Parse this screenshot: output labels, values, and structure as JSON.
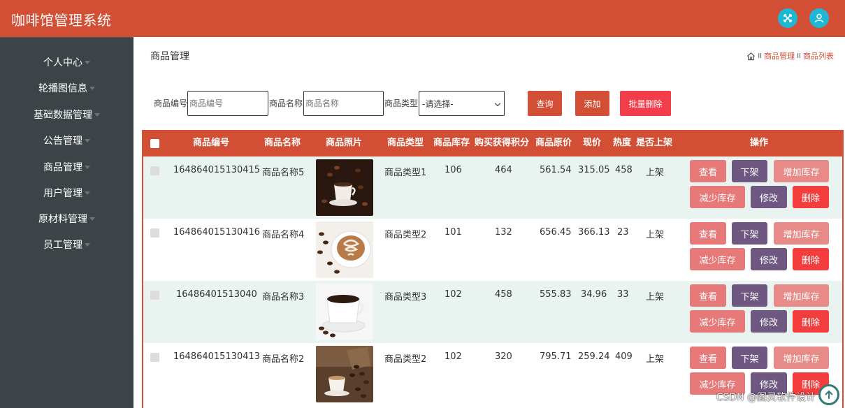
{
  "app": {
    "title": "咖啡馆管理系统"
  },
  "sidebar": {
    "items": [
      {
        "label": "个人中心"
      },
      {
        "label": "轮播图信息"
      },
      {
        "label": "基础数据管理"
      },
      {
        "label": "公告管理"
      },
      {
        "label": "商品管理"
      },
      {
        "label": "用户管理"
      },
      {
        "label": "原材料管理"
      },
      {
        "label": "员工管理"
      }
    ]
  },
  "page": {
    "title": "商品管理",
    "breadcrumb": {
      "sep": "II",
      "level1": "商品管理",
      "level2": "商品列表"
    }
  },
  "filters": {
    "code": {
      "label": "商品编号",
      "placeholder": "商品编号"
    },
    "name": {
      "label": "商品名称",
      "placeholder": "商品名称"
    },
    "type": {
      "label": "商品类型",
      "value": "-请选择-"
    },
    "search_label": "查询",
    "add_label": "添加",
    "batch_delete_label": "批量删除"
  },
  "colors": {
    "brand": "#d24e34",
    "sidebar": "#3d4447",
    "header_button": "#1fb7d6",
    "view": "#e77a78",
    "offline": "#6e5882",
    "delete": "#f43d3d"
  },
  "table": {
    "headers": {
      "code": "商品编号",
      "name": "商品名称",
      "photo": "商品照片",
      "type": "商品类型",
      "stock": "商品库存",
      "points": "购买获得积分",
      "orig_price": "商品原价",
      "price": "现价",
      "hot": "热度",
      "listed": "是否上架",
      "ops": "操作"
    },
    "actions": {
      "view": "查看",
      "offline": "下架",
      "add_stock": "增加库存",
      "reduce_stock": "减少库存",
      "edit": "修改",
      "delete": "删除"
    },
    "rows": [
      {
        "code": "164864015130415",
        "name": "商品名称5",
        "photo": "coffee-beans-cup-icon",
        "type": "商品类型1",
        "stock": "106",
        "points": "464",
        "orig_price": "561.54",
        "price": "315.05",
        "hot": "458",
        "listed": "上架"
      },
      {
        "code": "164864015130416",
        "name": "商品名称4",
        "photo": "latte-art-icon",
        "type": "商品类型2",
        "stock": "101",
        "points": "132",
        "orig_price": "656.45",
        "price": "366.13",
        "hot": "23",
        "listed": "上架"
      },
      {
        "code": "16486401513040",
        "name": "商品名称3",
        "photo": "coffee-cup-icon",
        "type": "商品类型3",
        "stock": "102",
        "points": "458",
        "orig_price": "555.83",
        "price": "34.96",
        "hot": "33",
        "listed": "上架"
      },
      {
        "code": "164864015130413",
        "name": "商品名称2",
        "photo": "espresso-beans-icon",
        "type": "商品类型2",
        "stock": "102",
        "points": "320",
        "orig_price": "795.71",
        "price": "259.24",
        "hot": "409",
        "listed": "上架"
      }
    ]
  },
  "watermark": "CSDN @图灵软件设计"
}
